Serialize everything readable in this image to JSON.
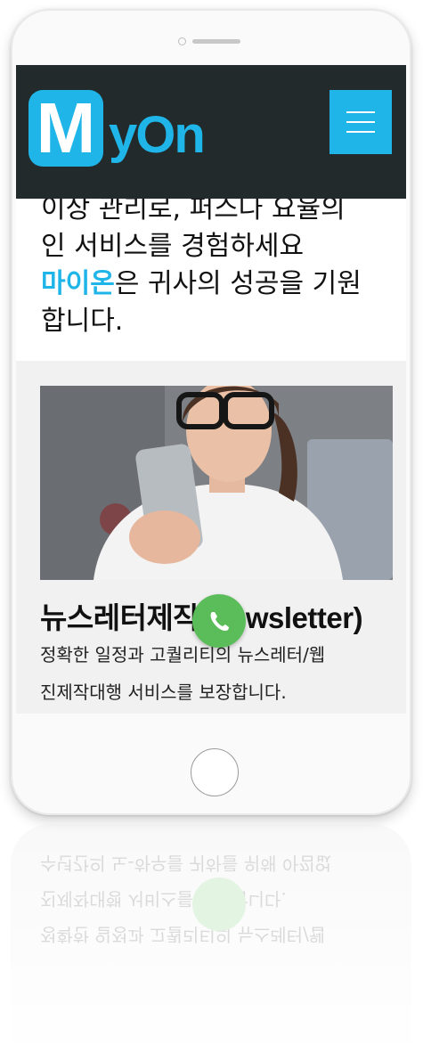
{
  "header": {
    "logo_letter": "M",
    "logo_rest": "yOn",
    "menu_icon": "hamburger-icon",
    "accent_color": "#1fb5e8",
    "bg_color": "#222a2b"
  },
  "intro": {
    "line1": "이상 관리로, 퍼스나 요율의",
    "line2": "인 서비스를 경험하세요",
    "line3_highlight": "마이온",
    "line3_rest": "은 귀사의 성공을 기원",
    "line4": "합니다."
  },
  "newsletter": {
    "title_ko": "뉴스레터제작",
    "title_en": "(Newsletter)",
    "line1": "정확한 일정과 고퀄리티의 뉴스레터/웹",
    "line2": "진제작대행 서비스를 보장합니다.",
    "line3": "수년간의 노-하우를 귀하를 위해 아낌없"
  },
  "actions": {
    "call_icon": "phone-icon",
    "call_color": "#5bbd5a"
  }
}
